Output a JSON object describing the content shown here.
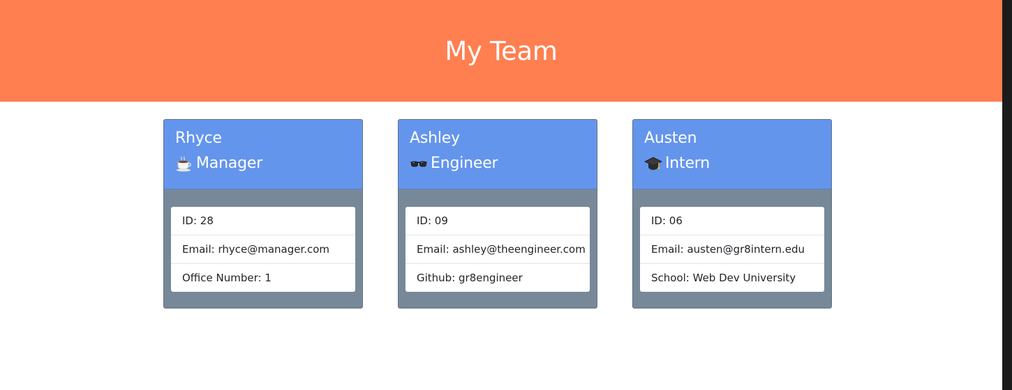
{
  "header": {
    "title": "My Team",
    "background_color": "#ff7f50"
  },
  "cards": [
    {
      "name": "Rhyce",
      "role": "Manager",
      "role_icon": "coffee-cup-icon",
      "details": [
        "ID: 28",
        "Email: rhyce@manager.com",
        "Office Number: 1"
      ]
    },
    {
      "name": "Ashley",
      "role": "Engineer",
      "role_icon": "glasses-icon",
      "details": [
        "ID: 09",
        "Email: ashley@theengineer.com",
        "Github: gr8engineer"
      ]
    },
    {
      "name": "Austen",
      "role": "Intern",
      "role_icon": "graduation-cap-icon",
      "details": [
        "ID: 06",
        "Email: austen@gr8intern.edu",
        "School: Web Dev University"
      ]
    }
  ],
  "colors": {
    "card_header": "#6495ed",
    "card_body": "#778899"
  }
}
